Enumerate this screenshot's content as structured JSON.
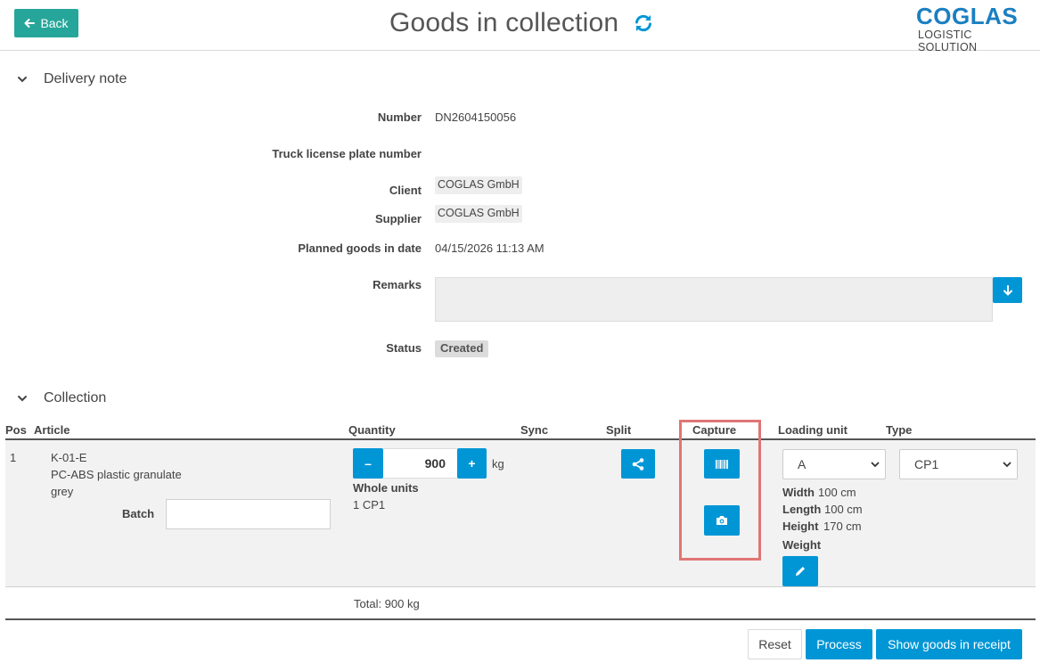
{
  "header": {
    "back_label": "Back",
    "title": "Goods in collection",
    "logo_main": "COGLAS",
    "logo_sub": "LOGISTIC SOLUTION"
  },
  "delivery_note": {
    "section_title": "Delivery note",
    "number_label": "Number",
    "number_value": "DN2604150056",
    "truck_label": "Truck license plate number",
    "truck_value": "",
    "client_label": "Client",
    "client_value": "COGLAS GmbH",
    "supplier_label": "Supplier",
    "supplier_value": "COGLAS GmbH",
    "planned_label": "Planned goods in date",
    "planned_value": "04/15/2026 11:13 AM",
    "remarks_label": "Remarks",
    "remarks_value": "",
    "status_label": "Status",
    "status_value": "Created"
  },
  "collection": {
    "section_title": "Collection",
    "columns": {
      "pos": "Pos",
      "article": "Article",
      "quantity": "Quantity",
      "sync": "Sync",
      "split": "Split",
      "capture": "Capture",
      "loading_unit": "Loading unit",
      "type": "Type"
    },
    "row": {
      "pos": "1",
      "article_code": "K-01-E",
      "article_desc_1": "PC-ABS plastic granulate",
      "article_desc_2": "grey",
      "batch_label": "Batch",
      "batch_value": "",
      "quantity_value": "900",
      "quantity_unit": "kg",
      "minus_label": "–",
      "plus_label": "+",
      "whole_units_label": "Whole units",
      "whole_units_value": "1 CP1",
      "loading_unit_selected": "A",
      "type_selected": "CP1",
      "width_label": "Width",
      "width_value": "100 cm",
      "length_label": "Length",
      "length_value": "100 cm",
      "height_label": "Height",
      "height_value": "170 cm",
      "weight_label": "Weight"
    },
    "total": "Total:  900 kg"
  },
  "footer": {
    "reset_label": "Reset",
    "process_label": "Process",
    "show_label": "Show goods in receipt"
  },
  "colors": {
    "accent": "#0096d6",
    "back_button": "#26a69a",
    "highlight": "#e07575",
    "logo": "#1a7fc1"
  },
  "icons": {
    "back": "arrow-left-icon",
    "refresh": "refresh-icon",
    "section": "chevron-down-icon",
    "remarks": "arrow-down-icon",
    "split": "share-icon",
    "capture_barcode": "barcode-icon",
    "capture_photo": "camera-icon",
    "weight": "pencil-icon"
  }
}
